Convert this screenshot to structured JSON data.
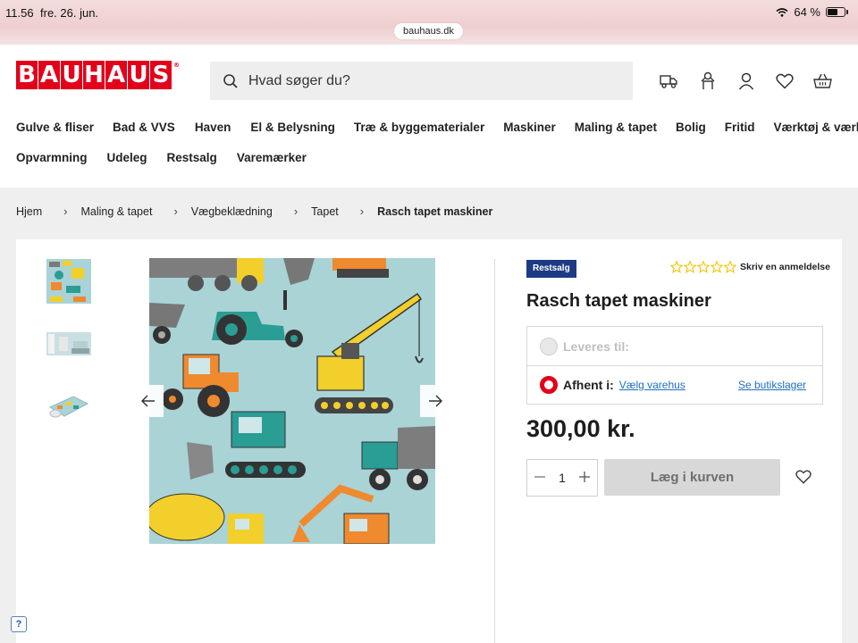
{
  "status_bar": {
    "time": "11.56",
    "date": "fre. 26. jun.",
    "battery": "64 %",
    "battery_level": 0.64
  },
  "browser": {
    "url": "bauhaus.dk"
  },
  "header": {
    "logo_letters": [
      "B",
      "A",
      "U",
      "H",
      "A",
      "U",
      "S"
    ],
    "search_placeholder": "Hvad søger du?",
    "icons": [
      "delivery-truck-icon",
      "store-locator-icon",
      "account-icon",
      "wishlist-heart-icon",
      "basket-icon"
    ]
  },
  "nav": {
    "row1": [
      "Gulve & fliser",
      "Bad & VVS",
      "Haven",
      "El & Belysning",
      "Træ & byggematerialer",
      "Maskiner",
      "Maling & tapet",
      "Bolig",
      "Fritid",
      "Værktøj & værksted"
    ],
    "row2": [
      "Opvarmning",
      "Udeleg",
      "Restsalg",
      "Varemærker"
    ]
  },
  "breadcrumb": {
    "items": [
      "Hjem",
      "Maling & tapet",
      "Vægbeklædning",
      "Tapet"
    ],
    "current": "Rasch tapet maskiner"
  },
  "product": {
    "badge": "Restsalg",
    "review_link": "Skriv en anmeldelse",
    "stars": 5,
    "title": "Rasch tapet maskiner",
    "delivery_label": "Leveres til:",
    "pickup_label": "Afhent i:",
    "pickup_link": "Vælg varehus",
    "stock_link": "Se butikslager",
    "price": "300,00 kr.",
    "quantity": "1",
    "add_to_cart": "Læg i kurven"
  },
  "help_button": "?",
  "colors": {
    "brand_red": "#e2001a",
    "badge_blue": "#1d3b85",
    "link_blue": "#1f6fbf",
    "star_yellow": "#f4c400"
  }
}
